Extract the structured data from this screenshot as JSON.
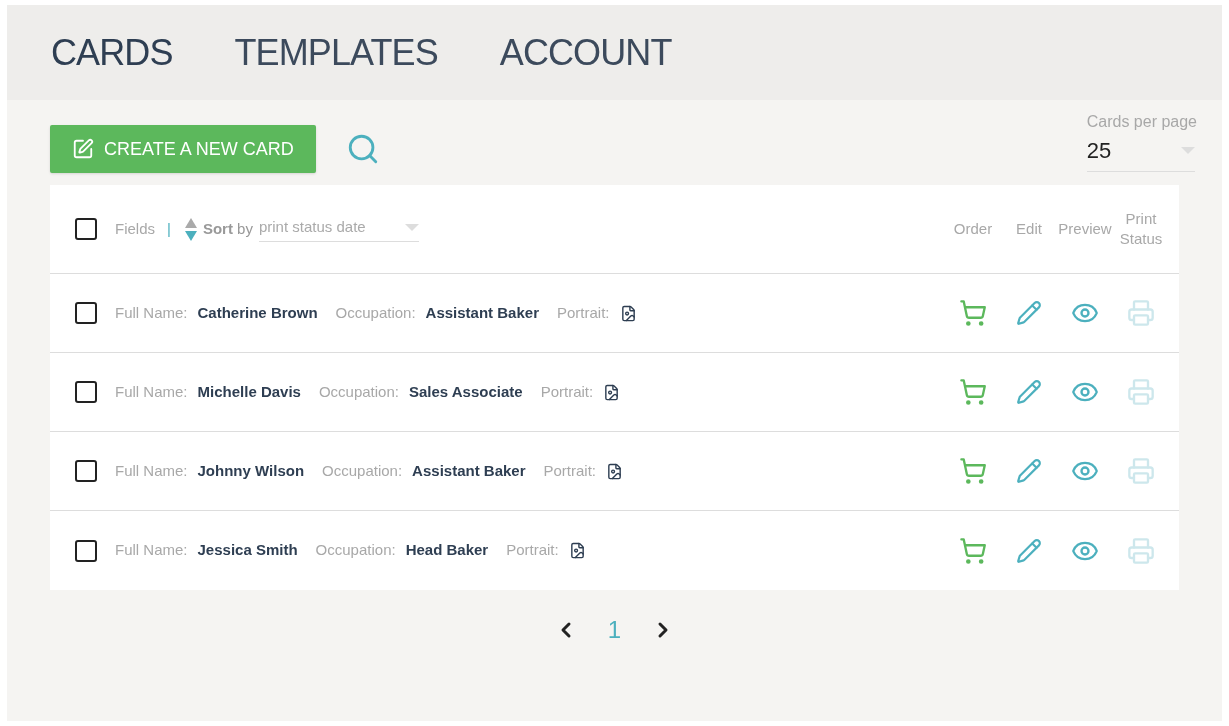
{
  "nav": [
    {
      "label": "CARDS",
      "selected": true
    },
    {
      "label": "TEMPLATES",
      "selected": false
    },
    {
      "label": "ACCOUNT",
      "selected": false
    }
  ],
  "create_button": "CREATE A NEW CARD",
  "per_page": {
    "label": "Cards per page",
    "value": "25"
  },
  "header": {
    "checked": false,
    "fields": "Fields",
    "separator": "|",
    "sort_label": "**Sort** by",
    "sort_value": "print status date",
    "columns": [
      "Order",
      "Edit",
      "Preview",
      "Print Status"
    ]
  },
  "rows": [
    {
      "checked": false,
      "fields": [
        {
          "label": "Full Name:",
          "value": "Catherine Brown",
          "kind": "text"
        },
        {
          "label": "Occupation:",
          "value": "Assistant Baker",
          "kind": "text"
        },
        {
          "label": "Portrait:",
          "kind": "file"
        }
      ]
    },
    {
      "checked": false,
      "fields": [
        {
          "label": "Full Name:",
          "value": "Michelle Davis",
          "kind": "text"
        },
        {
          "label": "Occupation:",
          "value": "Sales Associate",
          "kind": "text"
        },
        {
          "label": "Portrait:",
          "kind": "file"
        }
      ]
    },
    {
      "checked": false,
      "fields": [
        {
          "label": "Full Name:",
          "value": "Johnny Wilson",
          "kind": "text"
        },
        {
          "label": "Occupation:",
          "value": "Assistant Baker",
          "kind": "text"
        },
        {
          "label": "Portrait:",
          "kind": "file"
        }
      ]
    },
    {
      "checked": false,
      "fields": [
        {
          "label": "Full Name:",
          "value": "Jessica Smith",
          "kind": "text"
        },
        {
          "label": "Occupation:",
          "value": "Head Baker",
          "kind": "text"
        },
        {
          "label": "Portrait:",
          "kind": "file"
        }
      ]
    }
  ],
  "pagination": {
    "pages": [
      {
        "label": "1",
        "selected": true
      }
    ]
  }
}
